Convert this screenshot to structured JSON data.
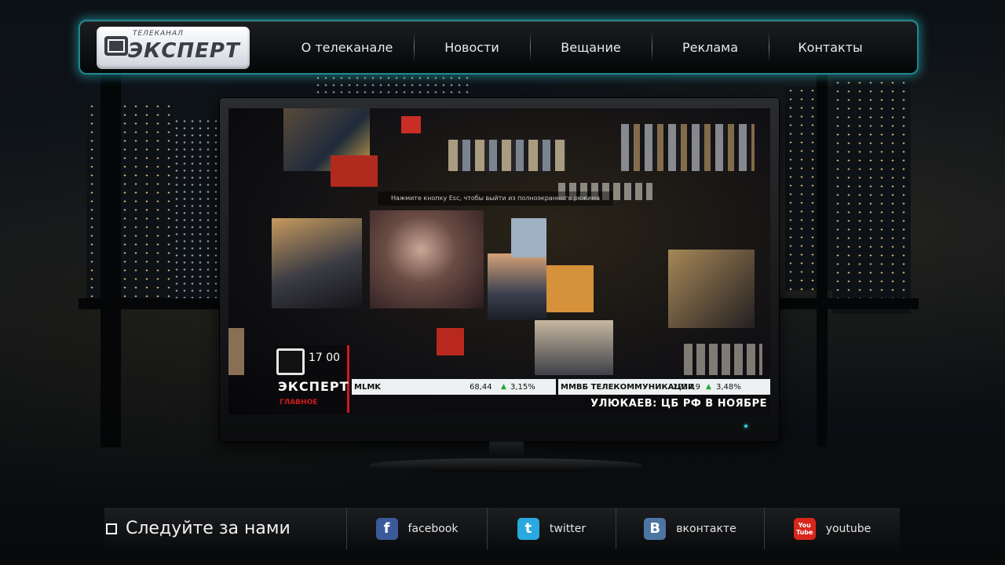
{
  "header": {
    "logo_small": "ТЕЛЕКАНАЛ",
    "logo_text": "ЭКСПЕРТ",
    "nav": [
      {
        "label": "О телеканале"
      },
      {
        "label": "Новости"
      },
      {
        "label": "Вещание"
      },
      {
        "label": "Реклама"
      },
      {
        "label": "Контакты"
      }
    ]
  },
  "player": {
    "hint": "Нажмите кнопку Esc, чтобы выйти из полноэкранного режима",
    "channel_time": "17 00",
    "channel_name": "ЭКСПЕРТ",
    "program_label": "ГЛАВНОЕ",
    "ticker": [
      {
        "name": "MLMK",
        "value": "68,44",
        "change": "3,15%",
        "direction": "up"
      },
      {
        "name": "ММВБ ТЕЛЕКОММУНИКАЦИИ",
        "value": "2234,9",
        "change": "3,48%",
        "direction": "up"
      }
    ],
    "headline": "УЛЮКАЕВ: ЦБ РФ В НОЯБРЕ"
  },
  "footer": {
    "follow_label": "Следуйте за нами",
    "social": [
      {
        "label": "facebook",
        "icon": "facebook-icon",
        "color": "#3b5a9a",
        "glyph": "f"
      },
      {
        "label": "twitter",
        "icon": "twitter-icon",
        "color": "#2aa9e0",
        "glyph": "t"
      },
      {
        "label": "вконтакте",
        "icon": "vkontakte-icon",
        "color": "#4c75a3",
        "glyph": "B"
      },
      {
        "label": "youtube",
        "icon": "youtube-icon",
        "color": "#d8261c",
        "glyph": "You\nTube"
      }
    ]
  },
  "colors": {
    "nav_glow": "#1f8790",
    "accent_red": "#d0191b",
    "ticker_up": "#1ea83a"
  }
}
